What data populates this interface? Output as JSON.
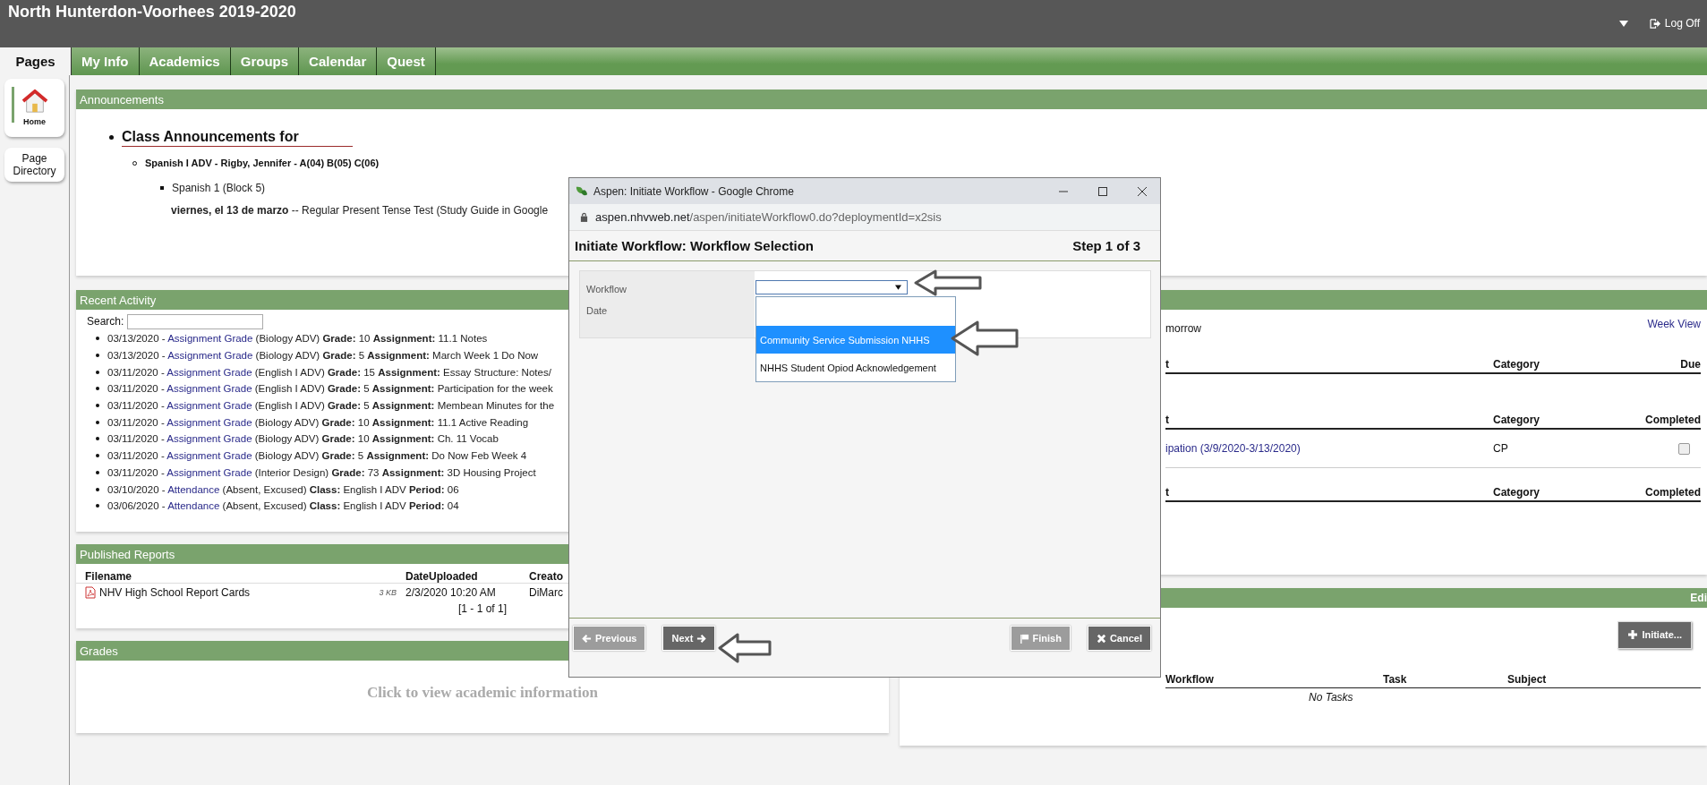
{
  "header": {
    "title": "North Hunterdon-Voorhees 2019-2020",
    "log_off": "Log Off"
  },
  "tabs": [
    {
      "label": "Pages",
      "selected": true
    },
    {
      "label": "My Info",
      "selected": false
    },
    {
      "label": "Academics",
      "selected": false
    },
    {
      "label": "Groups",
      "selected": false
    },
    {
      "label": "Calendar",
      "selected": false
    },
    {
      "label": "Quest",
      "selected": false
    }
  ],
  "sidebar": [
    {
      "label": "Home",
      "kind": "icon",
      "selected": true
    },
    {
      "label": "Page Directory",
      "kind": "text",
      "selected": false
    }
  ],
  "announcements": {
    "title": "Announcements",
    "heading": "Class Announcements for",
    "course": "Spanish I ADV - Rigby, Jennifer - A(04) B(05) C(06)",
    "class_name": "Spanish 1 (Block 5)",
    "entry": "**viernes, el 13 de marzo** -- Regular Present Tense Test (Study Guide in Google"
  },
  "recent_activity": {
    "title": "Recent Activity",
    "search_label": "Search:",
    "items": [
      {
        "date": "03/13/2020 -",
        "link": "Assignment Grade",
        "detail": "(Biology ADV) **Grade:** 10 **Assignment:** 11.1 Notes"
      },
      {
        "date": "03/13/2020 -",
        "link": "Assignment Grade",
        "detail": "(Biology ADV) **Grade:** 5 **Assignment:** March Week 1 Do Now"
      },
      {
        "date": "03/11/2020 -",
        "link": "Assignment Grade",
        "detail": "(English I ADV) **Grade:** 15 **Assignment:** Essay Structure: Notes/"
      },
      {
        "date": "03/11/2020 -",
        "link": "Assignment Grade",
        "detail": "(English I ADV) **Grade:** 5 **Assignment:** Participation for the week"
      },
      {
        "date": "03/11/2020 -",
        "link": "Assignment Grade",
        "detail": "(English I ADV) **Grade:** 5 **Assignment:** Membean Minutes for the"
      },
      {
        "date": "03/11/2020 -",
        "link": "Assignment Grade",
        "detail": "(Biology ADV) **Grade:** 10 **Assignment:** 11.1 Active Reading"
      },
      {
        "date": "03/11/2020 -",
        "link": "Assignment Grade",
        "detail": "(Biology ADV) **Grade:** 10 **Assignment:** Ch. 11 Vocab"
      },
      {
        "date": "03/11/2020 -",
        "link": "Assignment Grade",
        "detail": "(Biology ADV) **Grade:** 5 **Assignment:** Do Now Feb Week 4"
      },
      {
        "date": "03/11/2020 -",
        "link": "Assignment Grade",
        "detail": "(Interior Design) **Grade:** 73 **Assignment:** 3D Housing Project"
      },
      {
        "date": "03/10/2020 -",
        "link": "Attendance",
        "detail": "(Absent, Excused) **Class:** English I ADV **Period:** 06"
      },
      {
        "date": "03/06/2020 -",
        "link": "Attendance",
        "detail": "(Absent, Excused) **Class:** English I ADV **Period:** 04"
      }
    ]
  },
  "published_reports": {
    "title": "Published Reports",
    "columns": [
      "Filename",
      "DateUploaded",
      "Creato"
    ],
    "rows": [
      {
        "filename": "NHV High School Report Cards",
        "size": "3 KB",
        "date": "2/3/2020 10:20 AM",
        "creator": "DiMarc"
      }
    ],
    "pager": "[1 - 1 of 1]"
  },
  "grades": {
    "title": "Grades",
    "message": "Click to view academic information"
  },
  "upcoming": {
    "note": "morrow",
    "week_view": "Week View",
    "tables": [
      {
        "columns": [
          "t",
          "Category",
          "Due"
        ]
      },
      {
        "columns": [
          "t",
          "Category",
          "Completed"
        ],
        "rows": [
          {
            "assignment": "ipation (3/9/2020-3/13/2020)",
            "category": "CP",
            "completed": false
          }
        ]
      },
      {
        "columns": [
          "t",
          "Category",
          "Completed"
        ]
      }
    ]
  },
  "workflows": {
    "header_action": "Edi",
    "initiate": "Initiate...",
    "columns": [
      "Workflow",
      "Task",
      "Subject"
    ],
    "empty": "No Tasks"
  },
  "dialog": {
    "window_title": "Aspen: Initiate Workflow - Google Chrome",
    "url": {
      "host": "aspen.nhvweb.net",
      "path": "/aspen/initiateWorkflow0.do?deploymentId=x2sis"
    },
    "heading": "Initiate Workflow: Workflow Selection",
    "step": "Step 1 of 3",
    "fields": [
      {
        "label": "Workflow"
      },
      {
        "label": "Date"
      }
    ],
    "options": [
      {
        "label": "Community Service Submission NHHS",
        "selected": true
      },
      {
        "label": "NHHS Student Opiod Acknowledgement",
        "selected": false
      }
    ],
    "buttons": [
      {
        "label": "Previous",
        "kind": "previous",
        "disabled": true
      },
      {
        "label": "Next",
        "kind": "next",
        "disabled": false
      },
      {
        "label": "Finish",
        "kind": "finish",
        "disabled": true
      },
      {
        "label": "Cancel",
        "kind": "cancel",
        "disabled": false
      }
    ]
  }
}
